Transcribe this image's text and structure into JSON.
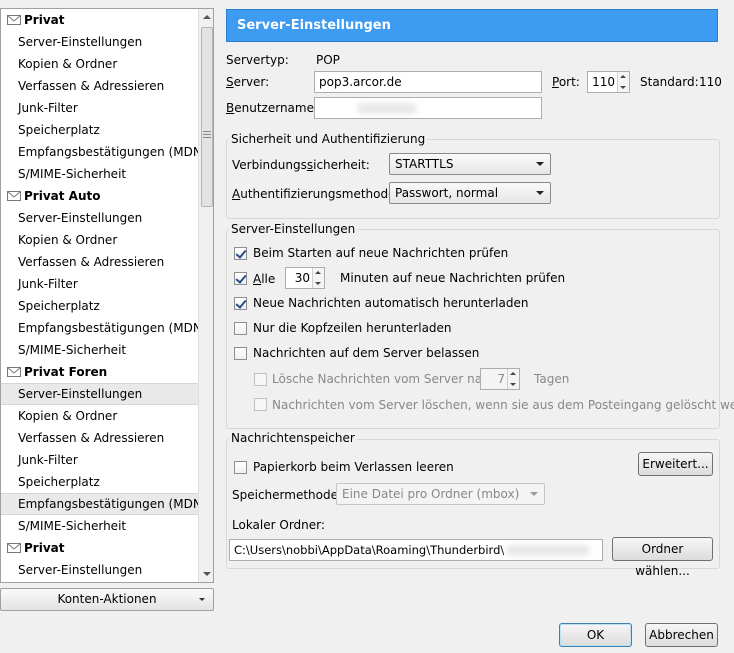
{
  "sidebar": {
    "accounts": [
      {
        "name": "Privat",
        "items": [
          "Server-Einstellungen",
          "Kopien & Ordner",
          "Verfassen & Adressieren",
          "Junk-Filter",
          "Speicherplatz",
          "Empfangsbestätigungen (MDN)",
          "S/MIME-Sicherheit"
        ]
      },
      {
        "name": "Privat Auto",
        "items": [
          "Server-Einstellungen",
          "Kopien & Ordner",
          "Verfassen & Adressieren",
          "Junk-Filter",
          "Speicherplatz",
          "Empfangsbestätigungen (MDN)",
          "S/MIME-Sicherheit"
        ]
      },
      {
        "name": "Privat Foren",
        "items": [
          "Server-Einstellungen",
          "Kopien & Ordner",
          "Verfassen & Adressieren",
          "Junk-Filter",
          "Speicherplatz",
          "Empfangsbestätigungen (MDN)",
          "S/MIME-Sicherheit"
        ]
      },
      {
        "name": "Privat",
        "items": [
          "Server-Einstellungen"
        ]
      }
    ],
    "account_actions_label": "Konten-Aktionen"
  },
  "main": {
    "title": "Server-Einstellungen",
    "server_type_label": "Servertyp:",
    "server_type_value": "POP",
    "server_label": "Server:",
    "server_value": "pop3.arcor.de",
    "port_label": "Port:",
    "port_value": "110",
    "standard_label": "Standard:",
    "standard_value": "110",
    "username_label": "Benutzername:",
    "security": {
      "title": "Sicherheit und Authentifizierung",
      "conn_label": "Verbindungssicherheit:",
      "conn_value": "STARTTLS",
      "auth_label": "Authentifizierungsmethode:",
      "auth_value": "Passwort, normal"
    },
    "server_settings": {
      "title": "Server-Einstellungen",
      "check_start": "Beim Starten auf neue Nachrichten prüfen",
      "every_label": "Alle",
      "every_value": "30",
      "every_suffix": "Minuten auf neue Nachrichten prüfen",
      "auto_download": "Neue Nachrichten automatisch herunterladen",
      "headers_only": "Nur die Kopfzeilen herunterladen",
      "leave_on_server": "Nachrichten auf dem Server belassen",
      "delete_after": "Lösche Nachrichten vom Server nach",
      "delete_days": "7",
      "days_label": "Tagen",
      "delete_on_remove": "Nachrichten vom Server löschen, wenn sie aus dem Posteingang gelöscht werden"
    },
    "storage": {
      "title": "Nachrichtenspeicher",
      "empty_trash": "Papierkorb beim Verlassen leeren",
      "advanced_button": "Erweitert...",
      "method_label": "Speichermethode:",
      "method_value": "Eine Datei pro Ordner (mbox)",
      "local_folder_label": "Lokaler Ordner:",
      "local_folder_value": "C:\\Users\\nobbi\\AppData\\Roaming\\Thunderbird\\",
      "choose_folder_button": "Ordner wählen..."
    }
  },
  "footer": {
    "ok": "OK",
    "cancel": "Abbrechen"
  }
}
